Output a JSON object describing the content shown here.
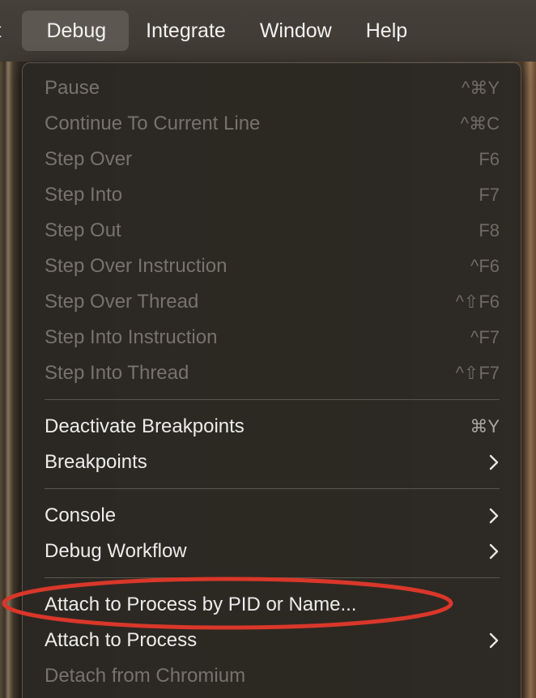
{
  "menubar": {
    "items": [
      {
        "label": "ct"
      },
      {
        "label": "Debug"
      },
      {
        "label": "Integrate"
      },
      {
        "label": "Window"
      },
      {
        "label": "Help"
      }
    ]
  },
  "menu": {
    "items": [
      {
        "label": "Pause",
        "shortcut": "^⌘Y",
        "enabled": false
      },
      {
        "label": "Continue To Current Line",
        "shortcut": "^⌘C",
        "enabled": false
      },
      {
        "label": "Step Over",
        "shortcut": "F6",
        "enabled": false
      },
      {
        "label": "Step Into",
        "shortcut": "F7",
        "enabled": false
      },
      {
        "label": "Step Out",
        "shortcut": "F8",
        "enabled": false
      },
      {
        "label": "Step Over Instruction",
        "shortcut": "^F6",
        "enabled": false
      },
      {
        "label": "Step Over Thread",
        "shortcut": "^⇧F6",
        "enabled": false
      },
      {
        "label": "Step Into Instruction",
        "shortcut": "^F7",
        "enabled": false
      },
      {
        "label": "Step Into Thread",
        "shortcut": "^⇧F7",
        "enabled": false
      },
      {
        "label": "Deactivate Breakpoints",
        "shortcut": "⌘Y",
        "enabled": true
      },
      {
        "label": "Breakpoints",
        "submenu": true,
        "enabled": true
      },
      {
        "label": "Console",
        "submenu": true,
        "enabled": true
      },
      {
        "label": "Debug Workflow",
        "submenu": true,
        "enabled": true
      },
      {
        "label": "Attach to Process by PID or Name...",
        "enabled": true,
        "annotated": true
      },
      {
        "label": "Attach to Process",
        "submenu": true,
        "enabled": true
      },
      {
        "label": "Detach from Chromium",
        "enabled": false
      }
    ]
  },
  "colors": {
    "annotation": "#d9372a",
    "menu_background": "#2b2823",
    "menubar_background": "#433e37",
    "active_menubar_item": "#5c5851"
  }
}
